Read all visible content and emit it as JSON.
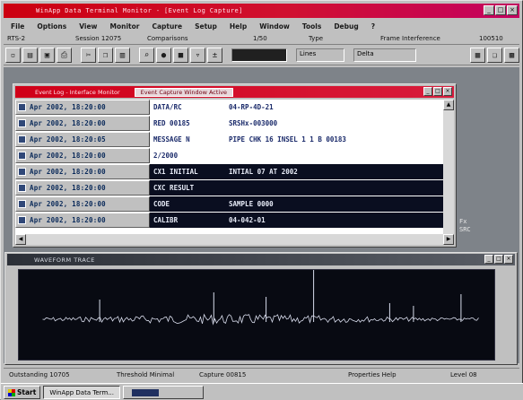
{
  "window": {
    "title": "WinApp Data Terminal Monitor - [Event Log Capture]",
    "controls": [
      "_",
      "□",
      "×"
    ]
  },
  "menu": [
    "File",
    "Options",
    "View",
    "Monitor",
    "Capture",
    "Setup",
    "Help",
    "Window",
    "Tools",
    "Debug",
    "?"
  ],
  "infobar": {
    "port": "RTS-2",
    "session": "Session 12075",
    "mode": "Comparisons",
    "count": "1/50",
    "type": "Type",
    "frame": "Frame Interference",
    "frame_value": "100510"
  },
  "toolbar": {
    "buttons": [
      "new-icon",
      "open-icon",
      "save-icon",
      "print-icon",
      "cut-icon",
      "copy-icon",
      "paste-icon",
      "find-icon",
      "capture-icon",
      "stop-icon",
      "filter-icon",
      "zoom-icon"
    ],
    "field1": "Lines",
    "field2": "Delta",
    "right_buttons": [
      "tile-icon",
      "cascade-icon",
      "grid-icon"
    ]
  },
  "child_window": {
    "title": "Event Log - Interface Monitor",
    "tab": "Event Capture Window Active",
    "controls": [
      "_",
      "□",
      "×"
    ]
  },
  "events": [
    {
      "time": "Apr 2002, 18:20:00",
      "col1": "DATA/RC",
      "col2": "04-RP-4D-21",
      "style": "light"
    },
    {
      "time": "Apr 2002, 18:20:00",
      "col1": "RED 00185",
      "col2": "SRSHx-003000",
      "style": "light"
    },
    {
      "time": "Apr 2002, 18:20:05",
      "col1": "MESSAGE N",
      "col2": "PIPE CHK 16 INSEL 1 1  B 00183",
      "style": "light"
    },
    {
      "time": "Apr 2002, 18:20:00",
      "col1": "2/2000",
      "col2": "",
      "style": "light"
    },
    {
      "time": "Apr 2002, 18:20:00",
      "col1": "CX1 INITIAL",
      "col2": "INTIAL        07 AT 2002",
      "style": "dark"
    },
    {
      "time": "Apr 2002, 18:20:00",
      "col1": "CXC RESULT",
      "col2": "",
      "style": "dark"
    },
    {
      "time": "Apr 2002, 18:20:00",
      "col1": "CODE",
      "col2": "SAMPLE 0000",
      "style": "dark"
    },
    {
      "time": "Apr 2002, 18:20:00",
      "col1": "CALIBR",
      "col2": "04-042-01",
      "style": "dark"
    }
  ],
  "side_icon_text": "Fx\nSRC",
  "wave_window": {
    "title": "WAVEFORM TRACE",
    "controls": [
      "_",
      "□",
      "×"
    ]
  },
  "waveform": {
    "baseline": 0.55,
    "spikes": [
      {
        "x": 0.17,
        "h": 0.22
      },
      {
        "x": 0.41,
        "h": 0.3
      },
      {
        "x": 0.52,
        "h": 0.25
      },
      {
        "x": 0.62,
        "h": 0.7
      },
      {
        "x": 0.78,
        "h": 0.18
      },
      {
        "x": 0.83,
        "h": 0.15
      },
      {
        "x": 0.93,
        "h": 0.28
      }
    ]
  },
  "statusbar": {
    "f1": "Outstanding 10705",
    "f2": "Threshold Minimal",
    "f3": "Capture 00815",
    "f4": "Properties Help",
    "f5": "Level 08"
  },
  "taskbar": {
    "start": "Start",
    "task1": "WinApp Data Term...",
    "task2": ""
  },
  "colors": {
    "title_red": "#cc0010",
    "dark_panel": "#0a0e20",
    "wave_trace": "#d8dcec"
  }
}
